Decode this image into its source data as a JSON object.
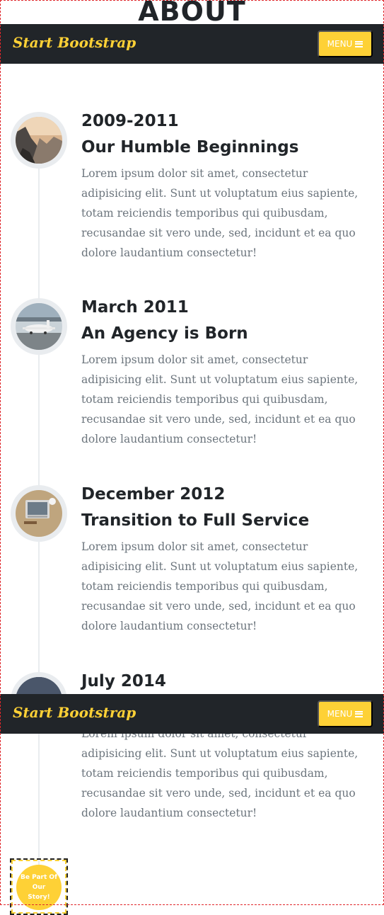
{
  "section": {
    "heading": "ABOUT"
  },
  "navbar": {
    "brand": "Start Bootstrap",
    "menu_label": "MENU",
    "menu_icon": "hamburger-icon",
    "accent": "#fed136",
    "background": "#212529"
  },
  "timeline": [
    {
      "date": "2009-2011",
      "subheading": "Our Humble Beginnings",
      "text": "Lorem ipsum dolor sit amet, consectetur adipisicing elit. Sunt ut voluptatum eius sapiente, totam reiciendis temporibus qui quibusdam, recusandae sit vero unde, sed, incidunt et ea quo dolore laudantium consectetur!",
      "image": "mountain-photo"
    },
    {
      "date": "March 2011",
      "subheading": "An Agency is Born",
      "text": "Lorem ipsum dolor sit amet, consectetur adipisicing elit. Sunt ut voluptatum eius sapiente, totam reiciendis temporibus qui quibusdam, recusandae sit vero unde, sed, incidunt et ea quo dolore laudantium consectetur!",
      "image": "airplane-photo"
    },
    {
      "date": "December 2012",
      "subheading": "Transition to Full Service",
      "text": "Lorem ipsum dolor sit amet, consectetur adipisicing elit. Sunt ut voluptatum eius sapiente, totam reiciendis temporibus qui quibusdam, recusandae sit vero unde, sed, incidunt et ea quo dolore laudantium consectetur!",
      "image": "laptop-photo"
    },
    {
      "date": "July 2014",
      "text": "Lorem ipsum dolor sit amet, consectetur adipisicing elit. Sunt ut voluptatum eius sapiente, totam reiciendis temporibus qui quibusdam, recusandae sit vero unde, sed, incidunt et ea quo dolore laudantium consectetur!",
      "image": "dark-photo"
    }
  ],
  "story": {
    "label": "Be Part Of Our Story!"
  }
}
